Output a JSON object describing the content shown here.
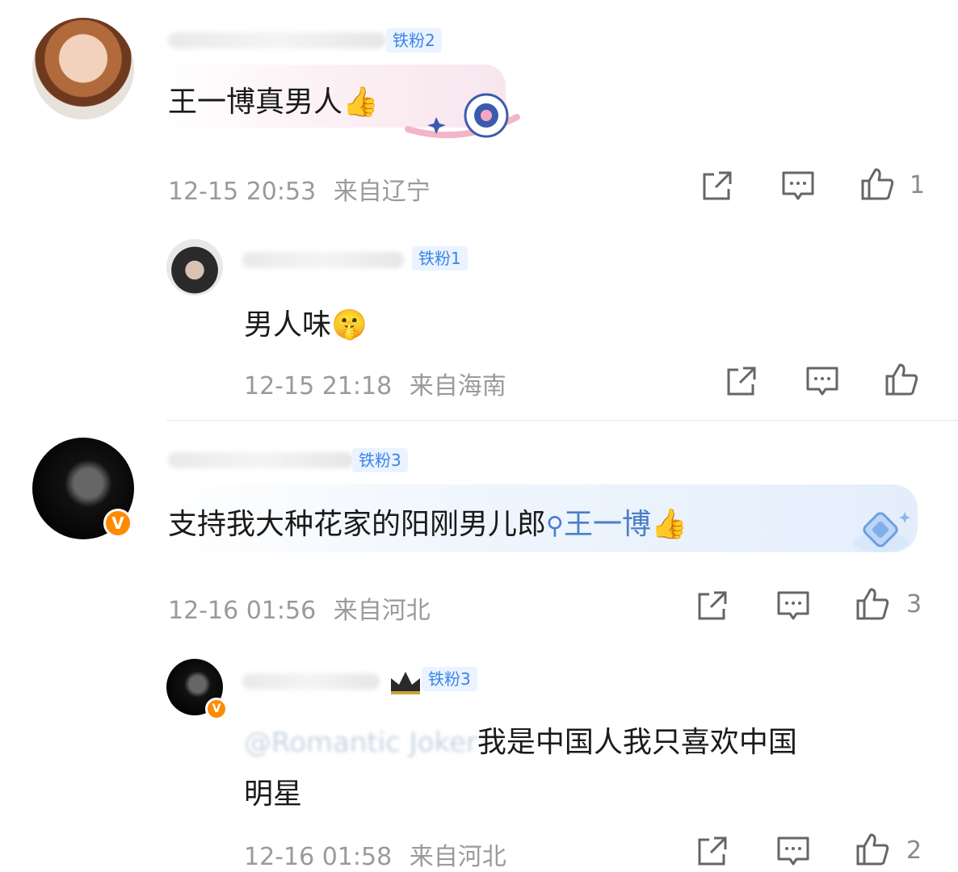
{
  "comments": [
    {
      "fan_level": "铁粉2",
      "text": "王一博真男人",
      "emoji": "👍",
      "time": "12-15 20:53",
      "location": "来自辽宁",
      "likes": "1",
      "avatar": "girl-portrait-avatar",
      "replies": [
        {
          "fan_level": "铁粉1",
          "text": "男人味",
          "emoji": "🤫",
          "time": "12-15 21:18",
          "location": "来自海南",
          "likes": "",
          "avatar": "hat-portrait-avatar"
        }
      ]
    },
    {
      "fan_level": "铁粉3",
      "text": "支持我大种花家的阳刚男儿郎",
      "link_text": "王一博",
      "emoji": "👍",
      "time": "12-16 01:56",
      "location": "来自河北",
      "likes": "3",
      "verified": "V",
      "avatar": "dark-portrait-avatar",
      "replies": [
        {
          "fan_level": "铁粉3",
          "mention_blurred": "@Romantic Joker",
          "text_line1": "我是中国人我只喜欢中国",
          "text_line2": "明星",
          "time": "12-16 01:58",
          "location": "来自河北",
          "likes": "2",
          "verified": "V",
          "avatar": "dark-portrait-avatar"
        }
      ]
    }
  ],
  "colors": {
    "fan_badge_bg": "#eaf3ff",
    "fan_badge_text": "#3a85e6",
    "meta_text": "#9a9a9a",
    "verified_badge": "#ff8a00",
    "link": "#4a7ec8"
  }
}
